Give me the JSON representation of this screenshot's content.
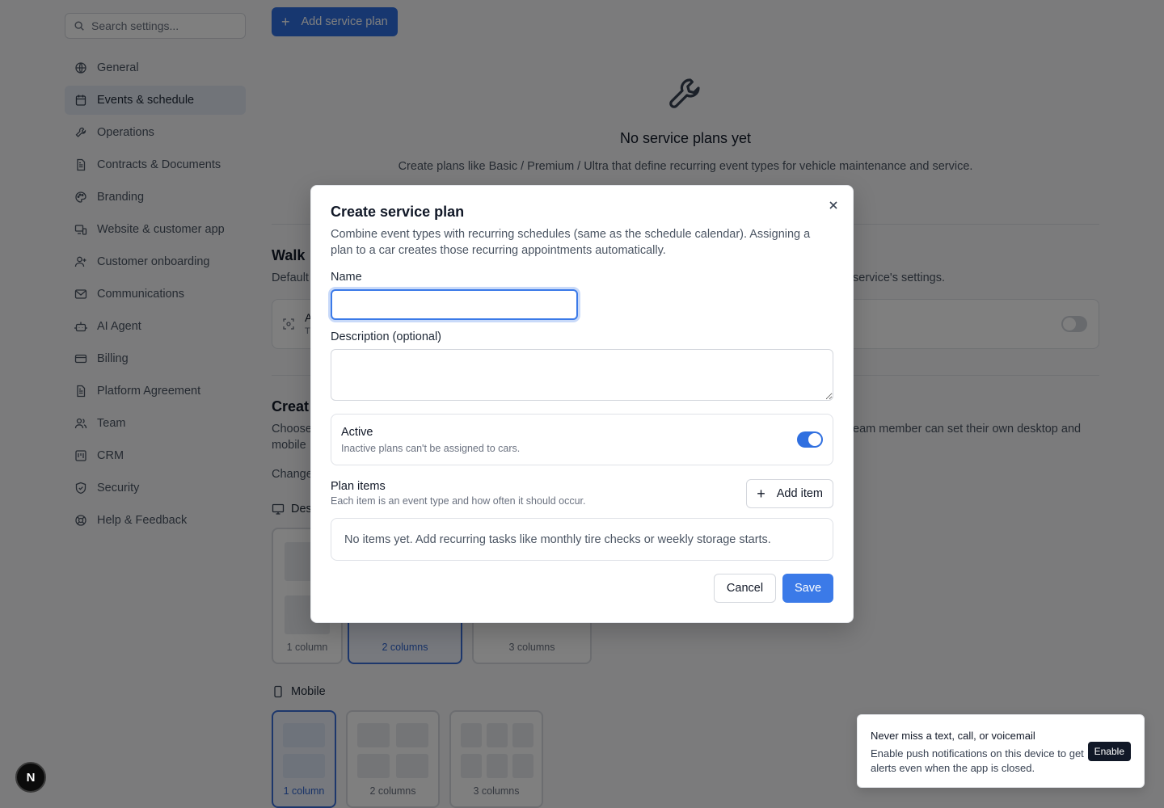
{
  "sidebar": {
    "search_placeholder": "Search settings...",
    "active_item": "Events & schedule",
    "items": [
      {
        "label": "General",
        "icon": "globe-icon"
      },
      {
        "label": "Events & schedule",
        "icon": "calendar-icon"
      },
      {
        "label": "Operations",
        "icon": "wrench-icon"
      },
      {
        "label": "Contracts & Documents",
        "icon": "document-icon"
      },
      {
        "label": "Branding",
        "icon": "palette-icon"
      },
      {
        "label": "Website & customer app",
        "icon": "devices-icon"
      },
      {
        "label": "Customer onboarding",
        "icon": "user-plus-icon"
      },
      {
        "label": "Communications",
        "icon": "mail-icon"
      },
      {
        "label": "AI Agent",
        "icon": "bot-icon"
      },
      {
        "label": "Billing",
        "icon": "credit-card-icon"
      },
      {
        "label": "Platform Agreement",
        "icon": "document-icon"
      },
      {
        "label": "Team",
        "icon": "users-icon"
      },
      {
        "label": "CRM",
        "icon": "crm-icon"
      },
      {
        "label": "Security",
        "icon": "shield-icon"
      },
      {
        "label": "Help & Feedback",
        "icon": "lifebuoy-icon"
      }
    ]
  },
  "main": {
    "add_plan_label": "Add service plan",
    "empty_title": "No service plans yet",
    "empty_desc": "Create plans like Basic / Premium / Ultra that define recurring event types for vehicle maintenance and service.",
    "walk_title": "Walk",
    "walk_desc_left": "Default",
    "walk_desc_right": "service's settings.",
    "walk_card_t1": "A",
    "walk_card_t2": "T",
    "create_title": "Creat",
    "create_desc_left_1": "Choose",
    "create_desc_left_2": "mobile",
    "create_desc_right": "eam member can set their own desktop and",
    "change_text": "Change",
    "desktop_label": "Des",
    "mobile_label": "Mobile",
    "desktop_options": [
      "1 column",
      "2 columns",
      "3 columns"
    ],
    "mobile_options": [
      "1 column",
      "2 columns",
      "3 columns"
    ]
  },
  "modal": {
    "title": "Create service plan",
    "description": "Combine event types with recurring schedules (same as the schedule calendar). Assigning a plan to a car creates those recurring appointments automatically.",
    "name_label": "Name",
    "name_value": "",
    "description_label": "Description (optional)",
    "description_value": "",
    "active_label": "Active",
    "active_sub": "Inactive plans can't be assigned to cars.",
    "active_on": true,
    "plan_items_title": "Plan items",
    "plan_items_sub": "Each item is an event type and how often it should occur.",
    "add_item_label": "Add item",
    "no_items_text": "No items yet. Add recurring tasks like monthly tire checks or weekly storage starts.",
    "cancel_label": "Cancel",
    "save_label": "Save"
  },
  "toast": {
    "title": "Never miss a text, call, or voicemail",
    "body": "Enable push notifications on this device to get alerts even when the app is closed.",
    "enable_label": "Enable"
  },
  "badge": {
    "letter": "N"
  },
  "colors": {
    "accent": "#2f6fe0",
    "overlay": "rgba(0,0,0,0.5)"
  }
}
